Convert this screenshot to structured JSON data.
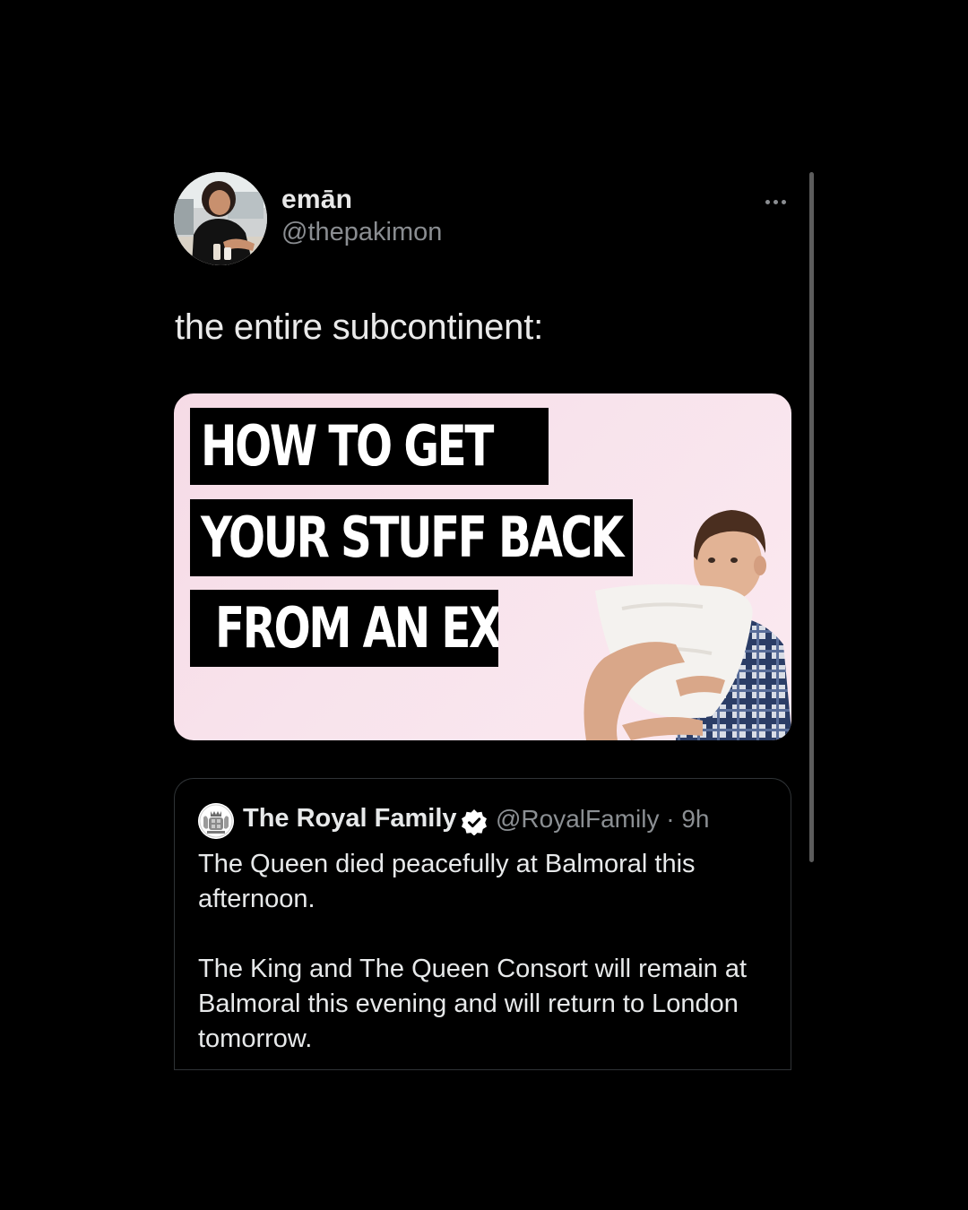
{
  "tweet": {
    "author": {
      "display_name": "emān",
      "handle": "@thepakimon",
      "avatar_icon": "user-avatar-photo"
    },
    "more_icon": "more-options-icon",
    "text": "the entire subcontinent:",
    "media": {
      "headline_lines": [
        "HOW TO GET",
        "YOUR STUFF BACK",
        "FROM AN EX"
      ],
      "illustration": "man-hugging-pillow"
    },
    "quote": {
      "author": {
        "display_name": "The Royal Family",
        "verified_icon": "verified-badge-icon",
        "handle_time": "@RoyalFamily · 9h",
        "avatar_icon": "royal-crest-icon"
      },
      "paragraphs": [
        "The Queen died peacefully at Balmoral this afternoon.",
        "The King and The Queen Consort will remain at Balmoral this evening and will return to London tomorrow."
      ]
    }
  },
  "colors": {
    "background": "#000000",
    "primary_text": "#e7e9ea",
    "secondary_text": "#8a8d91",
    "card_border": "#2f3336",
    "verified_badge": "#ffffff",
    "media_background": "#f8e3ec"
  }
}
